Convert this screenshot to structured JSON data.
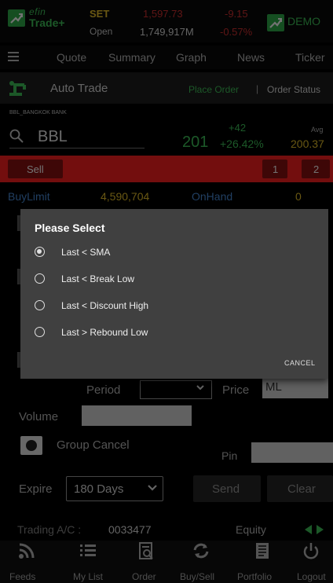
{
  "header": {
    "brand_line1": "efin",
    "brand_line2": "Trade+",
    "market": "SET",
    "session": "Open",
    "index_value": "1,597.73",
    "volume": "1,749,917M",
    "change": "-9.15",
    "change_pct": "-0.57%",
    "mode": "DEMO"
  },
  "nav": {
    "tabs": [
      "Quote",
      "Summary",
      "Graph",
      "News",
      "Ticker"
    ]
  },
  "autotrade": {
    "title": "Auto Trade",
    "place_order": "Place Order",
    "separator": "|",
    "order_status": "Order Status"
  },
  "stock": {
    "name": "BBL_BANGKOK BANK",
    "symbol": "BBL",
    "last": "201",
    "change": "+42",
    "change_pct": "+26.42%",
    "avg_label": "Avg",
    "avg": "200.37"
  },
  "side": {
    "sell_label": "Sell",
    "box1": "1",
    "box2": "2"
  },
  "account": {
    "buylimit_label": "BuyLimit",
    "buylimit_value": "4,590,704",
    "onhand_label": "OnHand",
    "onhand_value": "0"
  },
  "dialog": {
    "title": "Please Select",
    "options": [
      {
        "label": "Last < SMA",
        "selected": true
      },
      {
        "label": "Last < Break Low",
        "selected": false
      },
      {
        "label": "Last < Discount High",
        "selected": false
      },
      {
        "label": "Last > Rebound Low",
        "selected": false
      }
    ],
    "cancel": "CANCEL"
  },
  "form": {
    "period_label": "Period",
    "price_label": "Price",
    "price_value": "ML",
    "volume_label": "Volume",
    "group_cancel_label": "Group Cancel",
    "pin_label": "Pin",
    "expire_label": "Expire",
    "expire_value": "180 Days",
    "send_label": "Send",
    "clear_label": "Clear"
  },
  "footer_info": {
    "trading_ac_label": "Trading A/C :",
    "trading_ac_value": "0033477",
    "equity_label": "Equity"
  },
  "bottom_nav": [
    {
      "label": "Feeds",
      "icon": "feeds-icon"
    },
    {
      "label": "My List",
      "icon": "list-icon"
    },
    {
      "label": "Order",
      "icon": "order-icon"
    },
    {
      "label": "Buy/Sell",
      "icon": "buysell-icon"
    },
    {
      "label": "Portfolio",
      "icon": "portfolio-icon"
    },
    {
      "label": "Logout",
      "icon": "power-icon"
    }
  ],
  "colors": {
    "green": "#3fc35a",
    "red": "#d13030",
    "yellow": "#e8c22a",
    "blue": "#4a8cd9",
    "sell_red": "#ff2020"
  }
}
